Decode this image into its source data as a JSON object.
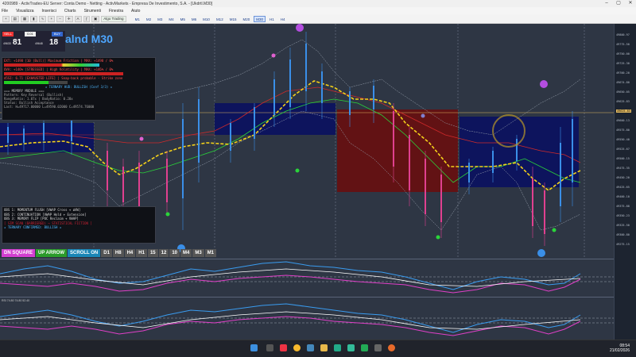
{
  "window": {
    "title": "4200989 - ActivTrades-EU Server: Conta Demo - Netting - ActivMarkets - Empresa De Investimento, S.A. - [Ukdrtl.M30]"
  },
  "menu": [
    "File",
    "Visualizza",
    "Inserisci",
    "Charts",
    "Strumenti",
    "Finestra",
    "Aiuto"
  ],
  "toolbar": {
    "algo_label": "Algo Trading",
    "timeframes": [
      "M1",
      "M2",
      "M3",
      "M4",
      "M5",
      "M6",
      "M10",
      "M12",
      "M15",
      "M20",
      "M30",
      "H1",
      "H4"
    ],
    "active_timeframe": "M30"
  },
  "trade_panel": {
    "sell_label": "SELL",
    "buy_label": "BUY",
    "lot": "0.01",
    "sell_price_small": "49633",
    "sell_price_big": "81",
    "buy_price_small": "49648",
    "buy_price_big": "18"
  },
  "chart_title": "alnd M30",
  "info_panel": {
    "lines": [
      "EXT: +1498 [10 (Bull)] Maximum Friction | MAX: +1498 / 0%",
      "OVA: +146% [STRESSED] | High Volatility | MAX: +146% / 0%",
      "d5SI: 6.71 [EXHAUSTED LIFE] | Snap-back probable - Strike zone",
      "★ TERNARY HUD: BULLISH (Conf 3/3) ★",
      "=== MEMORY MODULE ===",
      "Pattern: Key Reversal (Bullish)",
      "RangeRatio: 1.07x | BodyRatio: 0.28x",
      "Status: Bullish Acceptance",
      "Last: H=49717.00000 L=49590.02000 C=49574.76000"
    ]
  },
  "obs_panel": {
    "lines": [
      "OBS 1: MOMENTUM FLUSH [VWAP Cross + ΔVW]",
      "OBS 2: CONTINUATION [VWAP Hold + Extension]",
      "OBS 3: MEMORY FLIP [POC Reclaim + VWAP]",
      "[ SIM SCAN (BARRIERED) → STATISTICAL FICTION ]",
      "★ TERNARY CONFIRMED: BULLISH ★"
    ]
  },
  "bottom_buttons": [
    {
      "label": "DN SQUARE",
      "color": "#e040c8"
    },
    {
      "label": "UP ARROW",
      "color": "#2fa82f"
    },
    {
      "label": "SCROLL ON",
      "color": "#1e8fbf"
    },
    {
      "label": "D1",
      "color": "#555"
    },
    {
      "label": "H8",
      "color": "#555"
    },
    {
      "label": "H4",
      "color": "#555"
    },
    {
      "label": "H1",
      "color": "#555"
    },
    {
      "label": "15",
      "color": "#555"
    },
    {
      "label": "12",
      "color": "#555"
    },
    {
      "label": "10",
      "color": "#555"
    },
    {
      "label": "M4",
      "color": "#555"
    },
    {
      "label": "M3",
      "color": "#555"
    },
    {
      "label": "M1",
      "color": "#555"
    }
  ],
  "price_axis": [
    "49800.97",
    "49775.50",
    "49750.00",
    "49725.30",
    "49700.20",
    "49674.80",
    "49650.05",
    "49625.83",
    "49600.13",
    "49575.80",
    "49550.40",
    "49525.67",
    "49500.15",
    "49475.35",
    "49450.20",
    "49425.65",
    "49400.10",
    "49375.88",
    "49350.23",
    "49325.50",
    "49300.80",
    "49275.15"
  ],
  "price_marker": "49625.83",
  "subwindow2_label": "RSI 74.80 74.80 52.40",
  "taskbar": {
    "time": "08:54",
    "date": "21/02/2026"
  }
}
